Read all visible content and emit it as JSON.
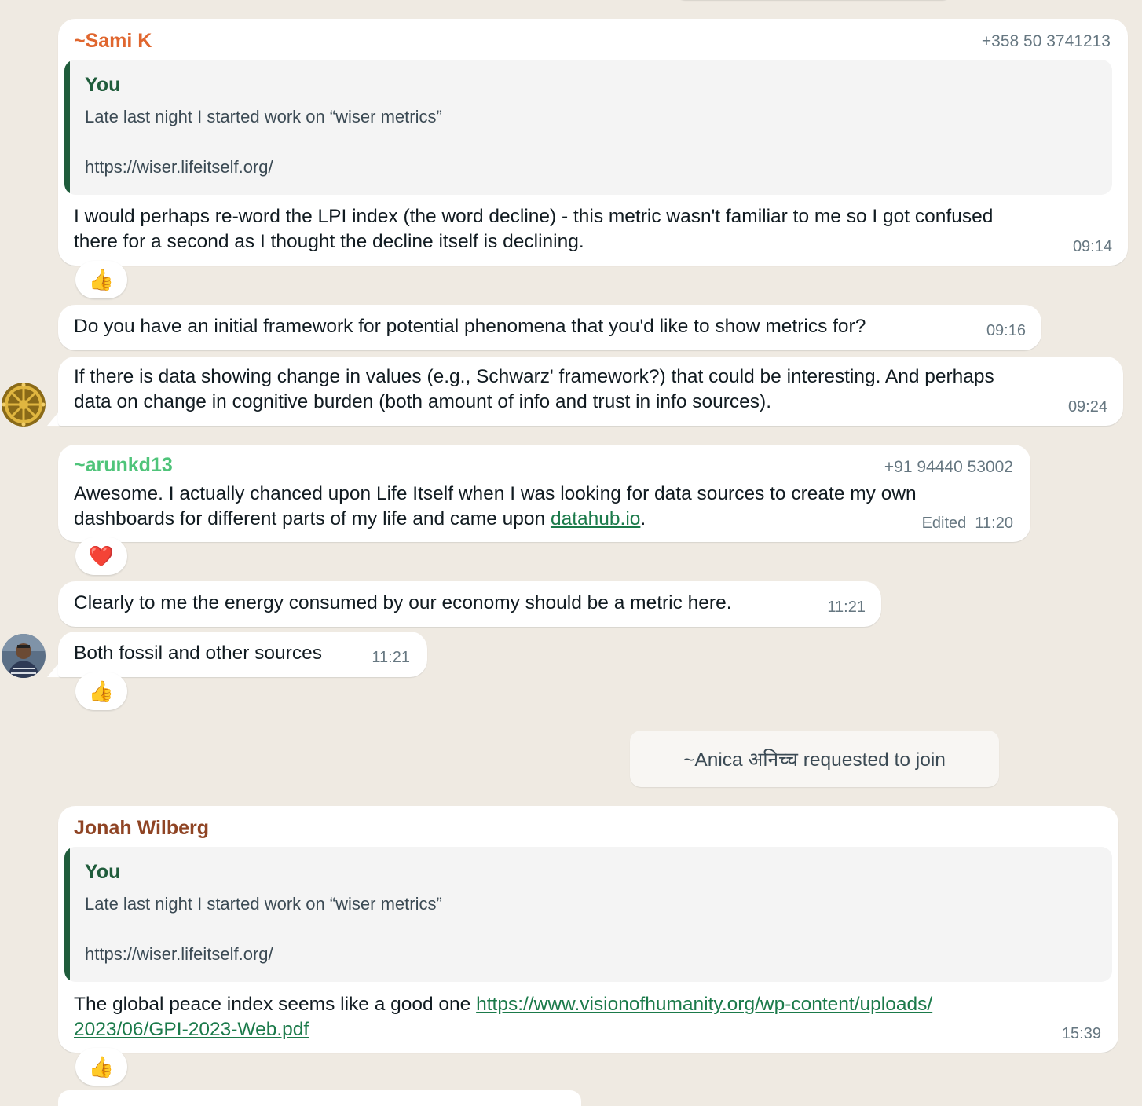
{
  "messages": {
    "sami": {
      "sender": "~Sami K",
      "phone": "+358 50 3741213",
      "quote_name": "You",
      "quote_line1": "Late last night I started work on “wiser metrics”",
      "quote_line2": "https://wiser.lifeitself.org/",
      "text_line1": "I would perhaps re-word the LPI index (the word decline) - this metric wasn't familiar to me so I got confused",
      "text_line2": "there for a second as I thought the decline itself is declining.",
      "time": "09:14",
      "reaction": "👍"
    },
    "msg2": {
      "text": "Do you have an initial framework for potential phenomena that you'd like to show metrics for?",
      "time": "09:16"
    },
    "msg3": {
      "text_line1": "If there is data showing change in values (e.g., Schwarz' framework?) that could be interesting. And perhaps",
      "text_line2": "data on change in cognitive burden (both amount of info and trust in info sources).",
      "time": "09:24"
    },
    "arun": {
      "sender": "~arunkd13",
      "phone": "+91 94440 53002",
      "text_line1": "Awesome. I actually chanced upon Life Itself when I was looking for data sources to create my own",
      "text_line2_pre": "dashboards for different parts of my life and came upon ",
      "link": "datahub.io",
      "text_line2_post": ".",
      "edited": "Edited",
      "time": "11:20",
      "reaction": "❤️"
    },
    "msg5": {
      "text": "Clearly to me the energy consumed by our economy should be a metric here.",
      "time": "11:21"
    },
    "msg6": {
      "text": "Both fossil and other sources",
      "time": "11:21",
      "reaction": "👍"
    },
    "system": {
      "text": "~Anica अनिच्च requested to join"
    },
    "jonah": {
      "sender": "Jonah Wilberg",
      "quote_name": "You",
      "quote_line1": "Late last night I started work on “wiser metrics”",
      "quote_line2": "https://wiser.lifeitself.org/",
      "text_pre": "The global peace index seems like a good one ",
      "link_line1": "https://www.visionofhumanity.org/wp-content/uploads/",
      "link_line2": "2023/06/GPI-2023-Web.pdf",
      "time": "15:39",
      "reaction": "👍"
    }
  },
  "colors": {
    "background": "#efeae2",
    "sami_name": "#e0662e",
    "arun_name": "#4fc47a",
    "jonah_name": "#8f4424",
    "quote_accent": "#1f5c3b",
    "link": "#1b7a4a"
  },
  "avatars": {
    "avatar1": "dharma-wheel-icon",
    "avatar2": "person-photo"
  }
}
